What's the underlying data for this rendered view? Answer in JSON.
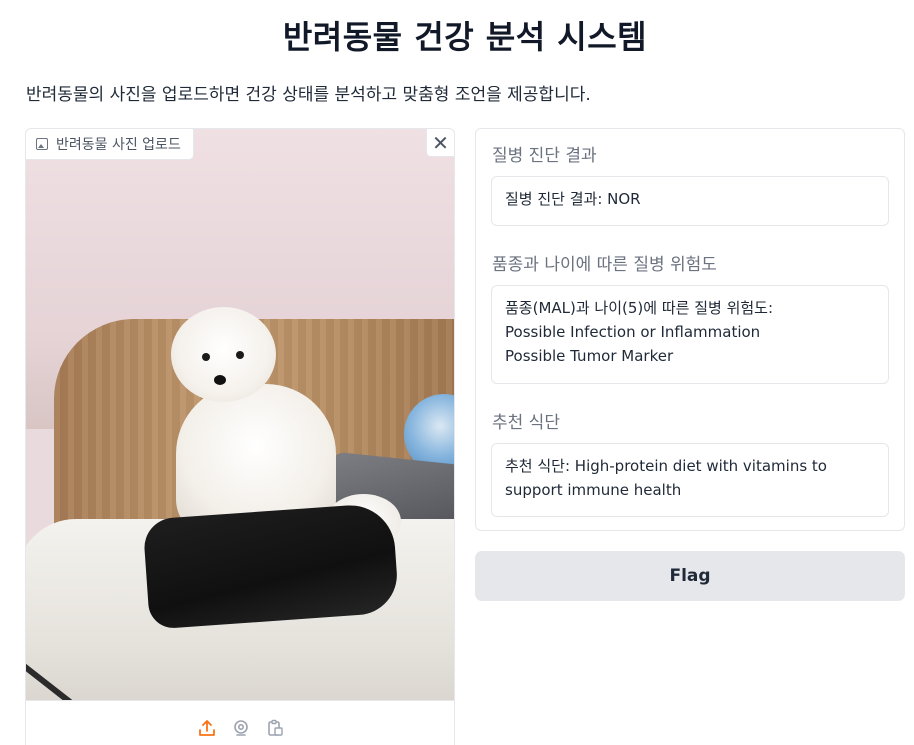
{
  "page": {
    "title": "반려동물 건강 분석 시스템",
    "description": "반려동물의 사진을 업로드하면 건강 상태를 분석하고 맞춤형 조언을 제공합니다."
  },
  "image_input": {
    "label": "반려동물 사진 업로드",
    "close_symbol": "✕",
    "toolbar_icons": [
      "upload-icon",
      "webcam-icon",
      "clipboard-icon"
    ],
    "accent_color": "#f97316"
  },
  "outputs": [
    {
      "label": "질병 진단 결과",
      "value": "질병 진단 결과: NOR"
    },
    {
      "label": "품종과 나이에 따른 질병 위험도",
      "value": "품종(MAL)과 나이(5)에 따른 질병 위험도:\nPossible Infection or Inflammation\nPossible Tumor Marker"
    },
    {
      "label": "추천 식단",
      "value": "추천 식단: High-protein diet with vitamins to support immune health"
    }
  ],
  "flag_button": {
    "label": "Flag"
  }
}
